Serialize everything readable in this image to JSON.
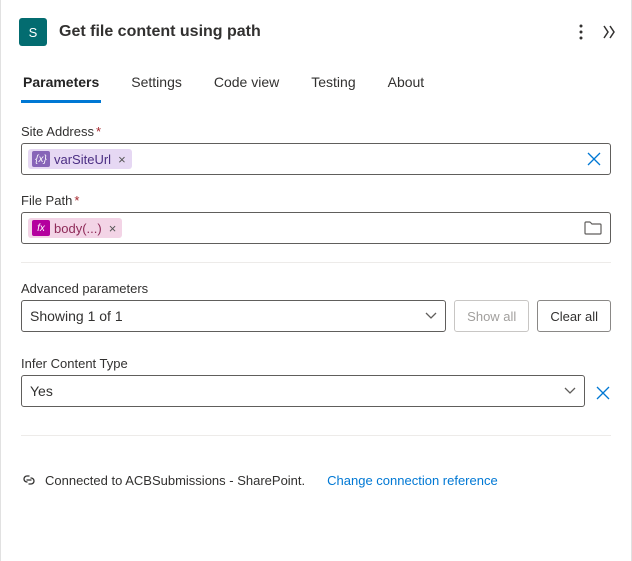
{
  "header": {
    "title": "Get file content using path",
    "app_icon_letter": "S"
  },
  "tabs": [
    {
      "label": "Parameters",
      "active": true
    },
    {
      "label": "Settings",
      "active": false
    },
    {
      "label": "Code view",
      "active": false
    },
    {
      "label": "Testing",
      "active": false
    },
    {
      "label": "About",
      "active": false
    }
  ],
  "fields": {
    "site_address": {
      "label": "Site Address",
      "required": "*",
      "token_text": "varSiteUrl",
      "token_badge": "{x}"
    },
    "file_path": {
      "label": "File Path",
      "required": "*",
      "token_text": "body(...)",
      "token_badge": "fx"
    }
  },
  "advanced": {
    "label": "Advanced parameters",
    "showing": "Showing 1 of 1",
    "show_all": "Show all",
    "clear_all": "Clear all"
  },
  "infer_content_type": {
    "label": "Infer Content Type",
    "value": "Yes"
  },
  "footer": {
    "connected_text": "Connected to ACBSubmissions - SharePoint.",
    "change_link": "Change connection reference"
  }
}
